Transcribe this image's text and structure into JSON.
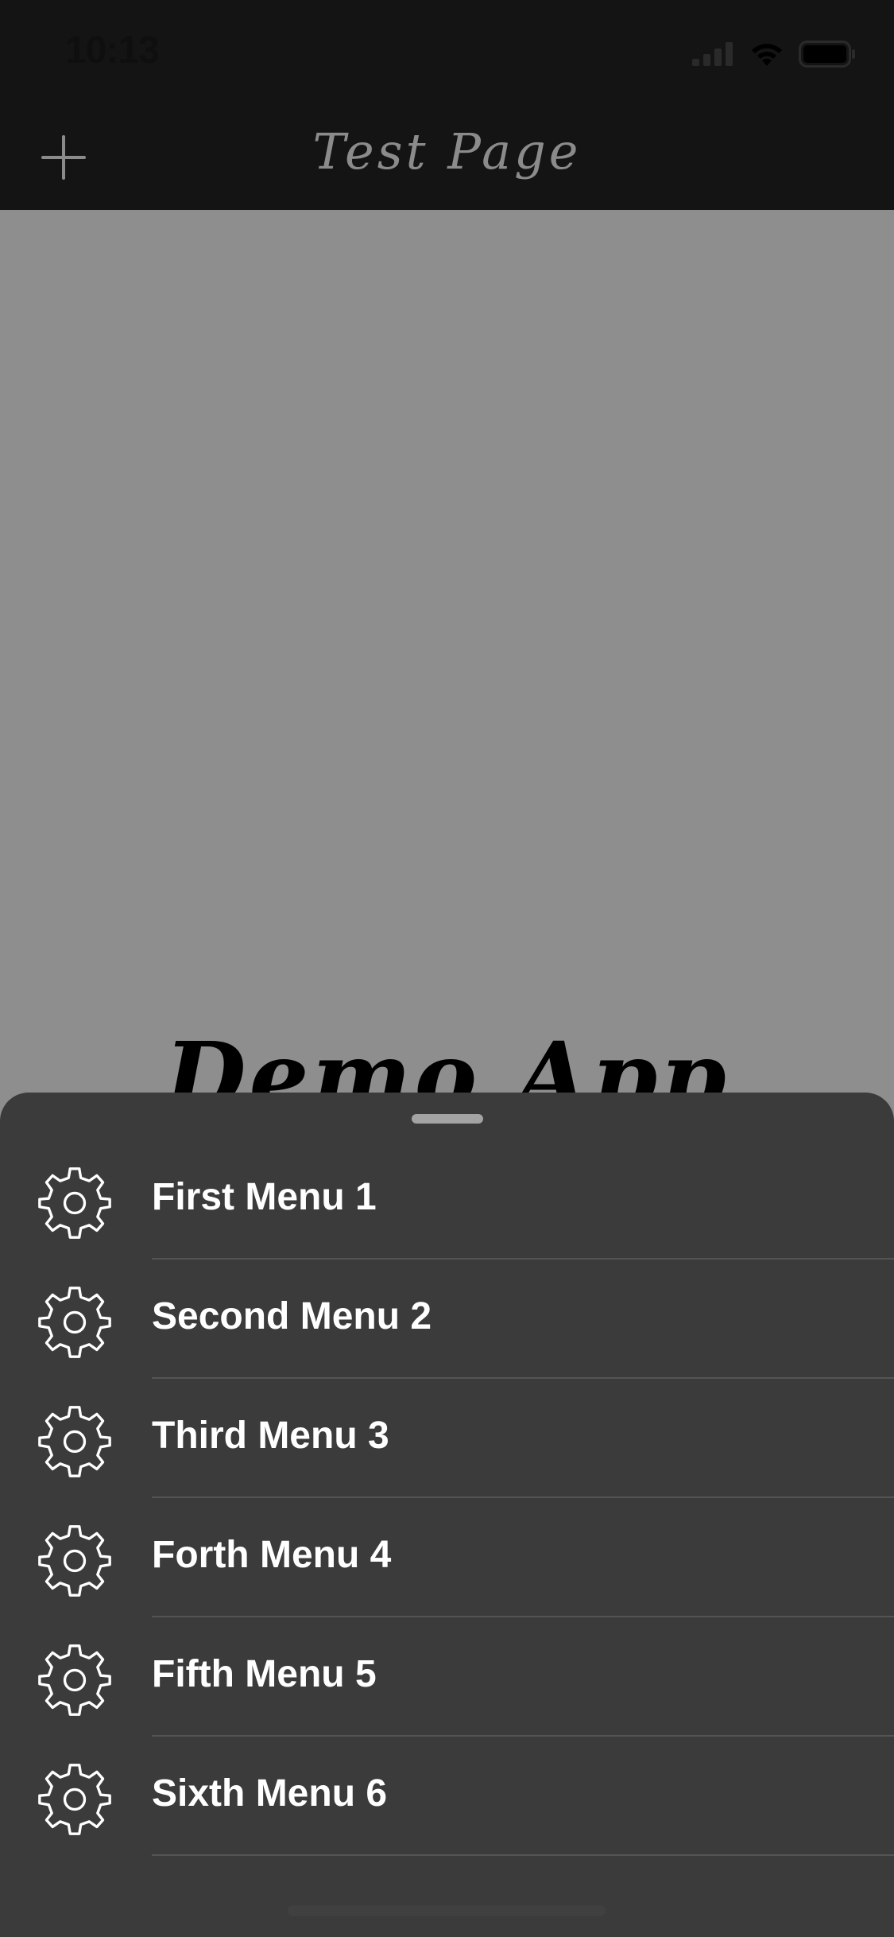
{
  "status_bar": {
    "time": "10:13"
  },
  "nav": {
    "title": "Test Page",
    "add_icon": "plus-icon"
  },
  "content": {
    "demo_title": "Demo App"
  },
  "menu": {
    "items": [
      {
        "label": "First Menu 1",
        "icon": "gear-icon"
      },
      {
        "label": "Second Menu 2",
        "icon": "gear-icon"
      },
      {
        "label": "Third Menu 3",
        "icon": "gear-icon"
      },
      {
        "label": "Forth Menu 4",
        "icon": "gear-icon"
      },
      {
        "label": "Fifth Menu 5",
        "icon": "gear-icon"
      },
      {
        "label": "Sixth Menu 6",
        "icon": "gear-icon"
      }
    ]
  },
  "colors": {
    "bar_background": "#141414",
    "content_background": "#8e8e8e",
    "sheet_background": "#3b3b3b",
    "title_text": "#8b8b8b",
    "menu_text": "#ffffff"
  }
}
